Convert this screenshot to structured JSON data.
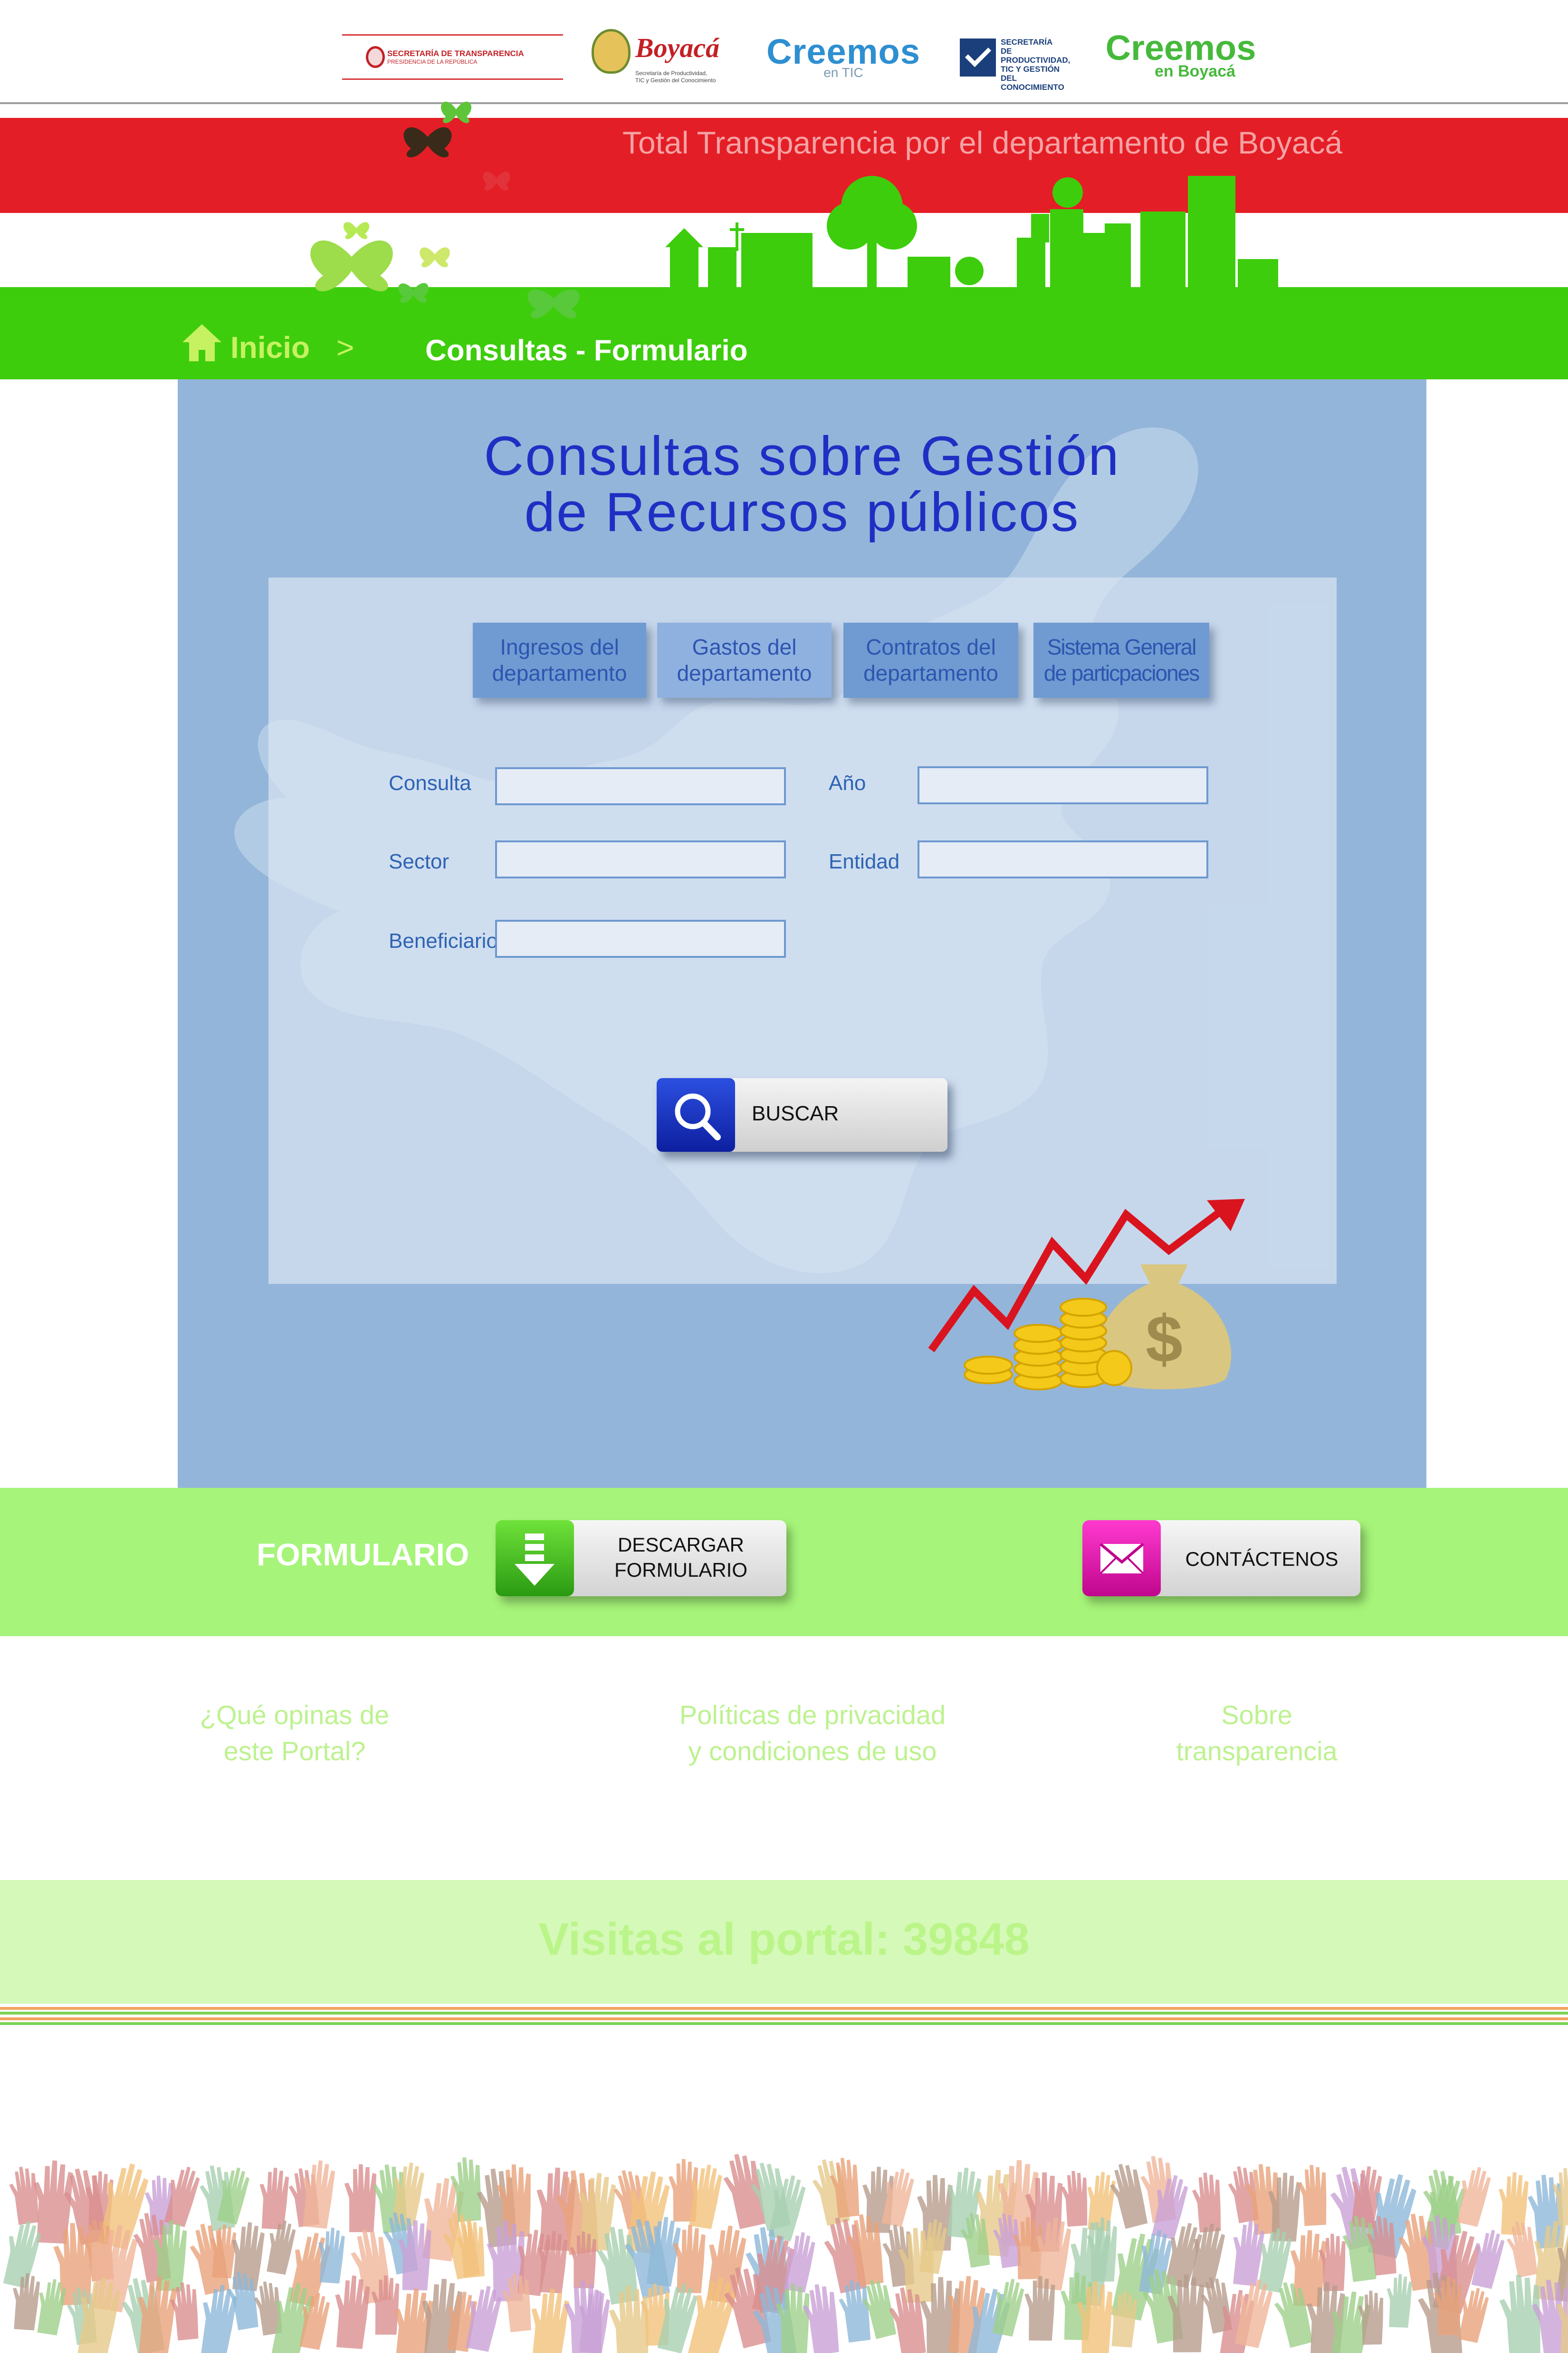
{
  "logos": {
    "secretaria_transparencia": {
      "line1": "SECRETARÍA DE TRANSPARENCIA",
      "line2": "PRESIDENCIA DE LA REPÚBLICA"
    },
    "boyaca": {
      "name": "Boyacá",
      "sub1": "Secretaría de Productividad,",
      "sub2": "TIC y Gestión del Conocimiento"
    },
    "creemos_tic": {
      "name": "Creemos",
      "sub": "en TIC"
    },
    "secretaria_productividad": {
      "line1": "SECRETARÍA",
      "line2": "DE PRODUCTIVIDAD,",
      "line3": "TIC Y GESTIÓN DEL",
      "line4": "CONOCIMIENTO"
    },
    "creemos_boyaca": {
      "name": "Creemos",
      "sub": "en Boyacá"
    }
  },
  "banner": {
    "title": "Total Transparencia por el departamento de Boyacá"
  },
  "breadcrumb": {
    "home": "Inicio",
    "separator": ">",
    "current": "Consultas - Formulario"
  },
  "main": {
    "title_line1": "Consultas sobre Gestión",
    "title_line2": "de Recursos públicos",
    "tabs": [
      {
        "line1": "Ingresos del",
        "line2": "departamento"
      },
      {
        "line1": "Gastos del",
        "line2": "departamento"
      },
      {
        "line1": "Contratos del",
        "line2": "departamento"
      },
      {
        "line1": "Sistema General",
        "line2": "de particpaciones"
      }
    ],
    "form": {
      "consulta": {
        "label": "Consulta",
        "value": "",
        "placeholder": ""
      },
      "anio": {
        "label": "Año",
        "value": "",
        "placeholder": ""
      },
      "sector": {
        "label": "Sector",
        "value": "",
        "placeholder": ""
      },
      "entidad": {
        "label": "Entidad",
        "value": "",
        "placeholder": ""
      },
      "beneficiario": {
        "label": "Beneficiario",
        "value": "",
        "placeholder": ""
      }
    },
    "search_button": "BUSCAR"
  },
  "formulario_band": {
    "heading": "FORMULARIO",
    "download_line1": "DESCARGAR",
    "download_line2": "FORMULARIO",
    "contact": "CONTÁCTENOS"
  },
  "footer_links": {
    "opinion_line1": "¿Qué opinas de",
    "opinion_line2": "este Portal?",
    "privacy_line1": "Políticas de privacidad",
    "privacy_line2": "y condiciones de uso",
    "about_line1": "Sobre",
    "about_line2": "transparencia"
  },
  "visits": {
    "text": "Visitas al portal: 39848"
  },
  "colors": {
    "red_band": "#e41e26",
    "green_band": "#3dcd0c",
    "panel_blue": "#93b5d9",
    "title_blue": "#1f2fc4",
    "light_green_band": "#a6f47a",
    "visits_band": "#d5f9b8"
  },
  "icons": {
    "home": "home-icon",
    "search": "magnifier-icon",
    "download": "download-arrow-icon",
    "contact": "envelope-icon"
  }
}
